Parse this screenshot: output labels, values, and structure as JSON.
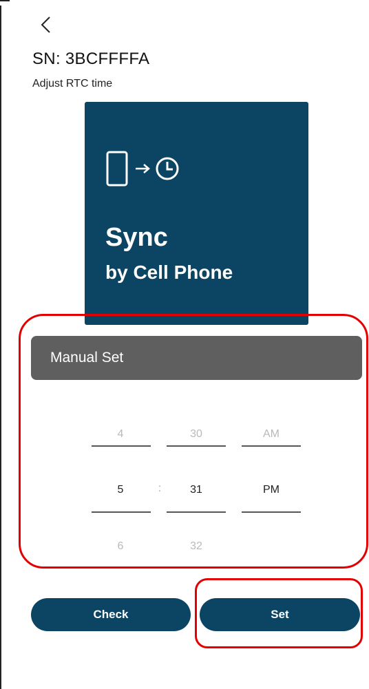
{
  "header": {
    "back_icon": "chevron-left-icon",
    "serial_title": "SN: 3BCFFFFA",
    "subtitle": "Adjust RTC time"
  },
  "sync_card": {
    "icons": [
      "phone-icon",
      "arrow-right-icon",
      "clock-icon"
    ],
    "title": "Sync",
    "subtitle": "by Cell Phone",
    "background": "#0b4563"
  },
  "manual_set": {
    "label": "Manual Set",
    "background": "#5f5f5f"
  },
  "time_picker": {
    "hour": {
      "prev": "4",
      "selected": "5",
      "next": "6"
    },
    "separator": ":",
    "minute": {
      "prev": "30",
      "selected": "31",
      "next": "32"
    },
    "period": {
      "prev": "AM",
      "selected": "PM"
    }
  },
  "buttons": {
    "check_label": "Check",
    "set_label": "Set",
    "color": "#0b4563"
  },
  "annotation_color": "#e20000"
}
